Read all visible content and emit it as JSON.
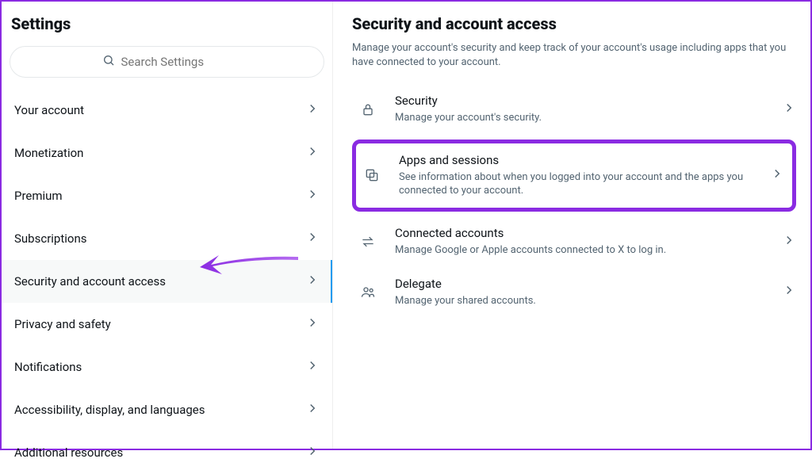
{
  "sidebar": {
    "title": "Settings",
    "search_placeholder": "Search Settings",
    "items": [
      {
        "label": "Your account"
      },
      {
        "label": "Monetization"
      },
      {
        "label": "Premium"
      },
      {
        "label": "Subscriptions"
      },
      {
        "label": "Security and account access"
      },
      {
        "label": "Privacy and safety"
      },
      {
        "label": "Notifications"
      },
      {
        "label": "Accessibility, display, and languages"
      },
      {
        "label": "Additional resources"
      }
    ],
    "active_index": 4
  },
  "content": {
    "title": "Security and account access",
    "description": "Manage your account's security and keep track of your account's usage including apps that you have connected to your account.",
    "options": [
      {
        "title": "Security",
        "desc": "Manage your account's security."
      },
      {
        "title": "Apps and sessions",
        "desc": "See information about when you logged into your account and the apps you connected to your account."
      },
      {
        "title": "Connected accounts",
        "desc": "Manage Google or Apple accounts connected to X to log in."
      },
      {
        "title": "Delegate",
        "desc": "Manage your shared accounts."
      }
    ],
    "highlighted_index": 1
  },
  "annotation": {
    "arrow_color": "#8a2be2"
  }
}
